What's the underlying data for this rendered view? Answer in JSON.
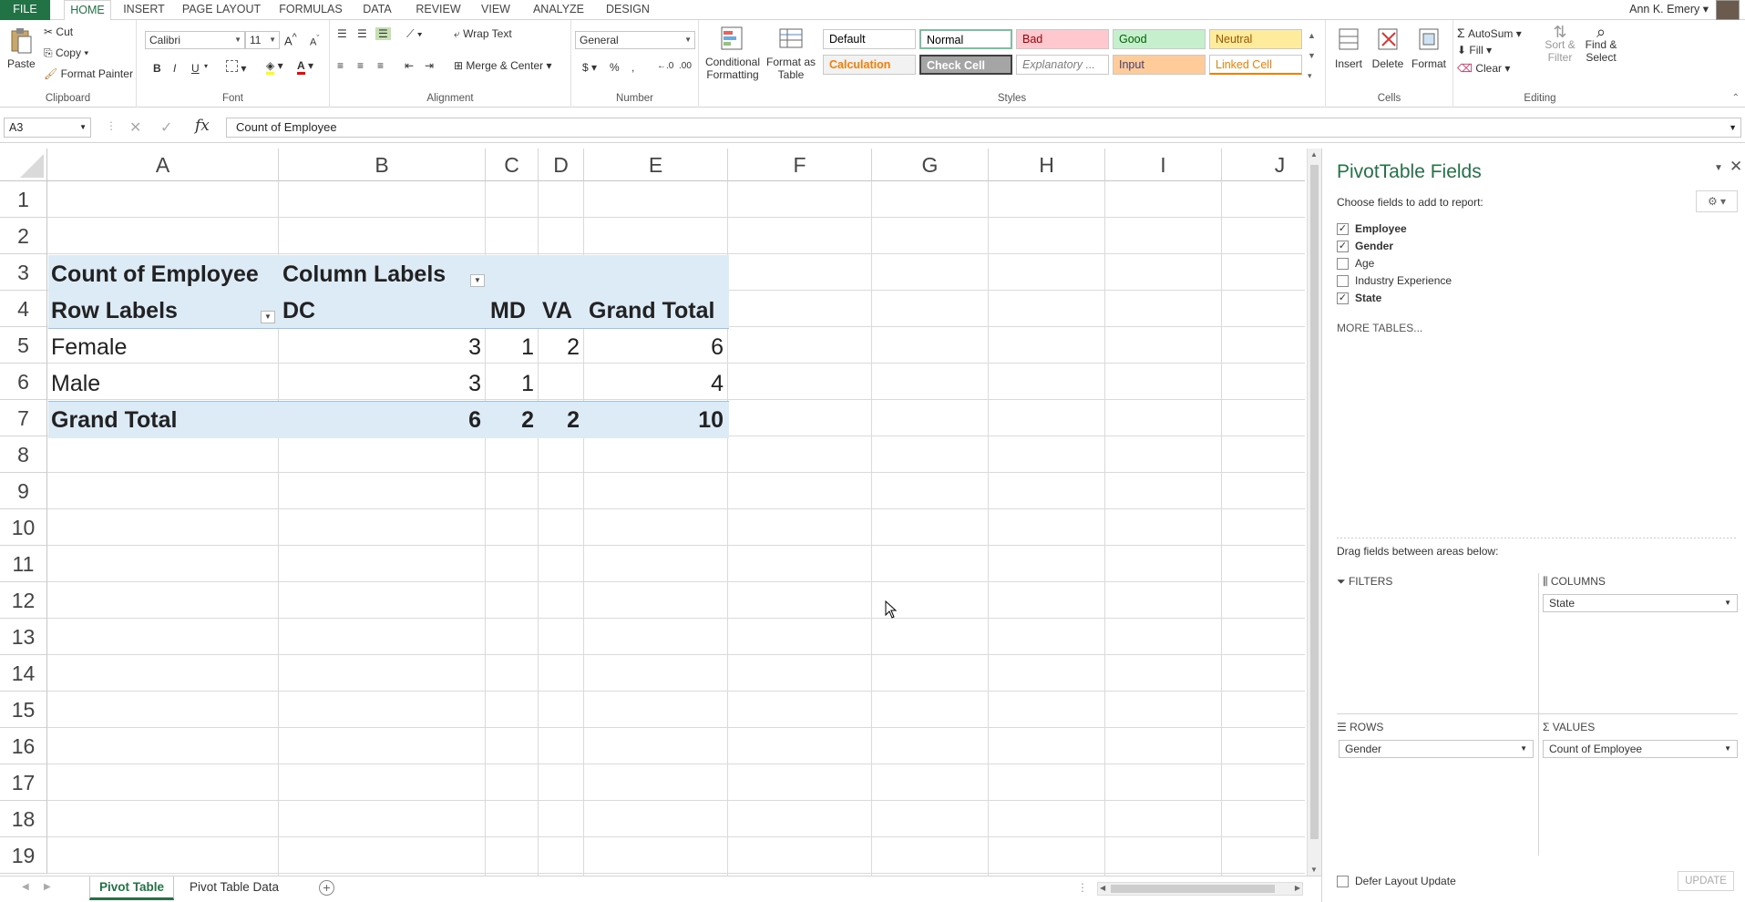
{
  "ribbon_tabs": [
    "FILE",
    "HOME",
    "INSERT",
    "PAGE LAYOUT",
    "FORMULAS",
    "DATA",
    "REVIEW",
    "VIEW",
    "ANALYZE",
    "DESIGN"
  ],
  "user_name": "Ann K. Emery",
  "clipboard": {
    "paste": "Paste",
    "cut": "Cut",
    "copy": "Copy",
    "format_painter": "Format Painter",
    "label": "Clipboard"
  },
  "font": {
    "name": "Calibri",
    "size": "11",
    "label": "Font",
    "bold": "B",
    "italic": "I",
    "underline": "U",
    "font_color_glyph": "A"
  },
  "alignment": {
    "wrap": "Wrap Text",
    "merge": "Merge & Center",
    "label": "Alignment"
  },
  "number": {
    "format": "General",
    "currency": "$",
    "percent": "%",
    "comma": ",",
    "label": "Number"
  },
  "styles_group": {
    "conditional": "Conditional Formatting",
    "format_table": "Format as Table",
    "label": "Styles",
    "cells": [
      {
        "name": "Default",
        "bg": "#ffffff",
        "fg": "#000000"
      },
      {
        "name": "Normal",
        "bg": "#ffffff",
        "fg": "#000000"
      },
      {
        "name": "Bad",
        "bg": "#ffc7ce",
        "fg": "#9c0006"
      },
      {
        "name": "Good",
        "bg": "#c6efce",
        "fg": "#006100"
      },
      {
        "name": "Neutral",
        "bg": "#ffeb9c",
        "fg": "#9c5700"
      },
      {
        "name": "Calculation",
        "bg": "#f2f2f2",
        "fg": "#fa7d00"
      },
      {
        "name": "Check Cell",
        "bg": "#a5a5a5",
        "fg": "#ffffff"
      },
      {
        "name": "Explanatory ...",
        "bg": "#ffffff",
        "fg": "#7f7f7f"
      },
      {
        "name": "Input",
        "bg": "#ffcc99",
        "fg": "#3f3f76"
      },
      {
        "name": "Linked Cell",
        "bg": "#ffffff",
        "fg": "#fa7d00"
      }
    ]
  },
  "cells_group": {
    "insert": "Insert",
    "delete": "Delete",
    "format": "Format",
    "label": "Cells"
  },
  "editing": {
    "autosum": "AutoSum",
    "fill": "Fill",
    "clear": "Clear",
    "sort": "Sort & Filter",
    "find": "Find & Select",
    "label": "Editing"
  },
  "formula_bar": {
    "name_box": "A3",
    "fx": "fx",
    "content": "Count of Employee"
  },
  "columns": [
    "A",
    "B",
    "C",
    "D",
    "E",
    "F",
    "G",
    "H",
    "I",
    "J"
  ],
  "rows": [
    "1",
    "2",
    "3",
    "4",
    "5",
    "6",
    "7",
    "8",
    "9",
    "10",
    "11",
    "12",
    "13",
    "14",
    "15",
    "16",
    "17",
    "18",
    "19"
  ],
  "pivot": {
    "corner": "Count of Employee",
    "column_labels": "Column Labels",
    "row_labels": "Row Labels",
    "states": [
      "DC",
      "MD",
      "VA"
    ],
    "grand_total_header": "Grand Total",
    "body": [
      {
        "label": "Female",
        "values": [
          "3",
          "1",
          "2"
        ],
        "total": "6"
      },
      {
        "label": "Male",
        "values": [
          "3",
          "1",
          ""
        ],
        "total": "4"
      }
    ],
    "grand_total": {
      "label": "Grand Total",
      "values": [
        "6",
        "2",
        "2"
      ],
      "total": "10"
    }
  },
  "sheets": [
    "Pivot Table",
    "Pivot Table Data"
  ],
  "pane": {
    "title": "PivotTable Fields",
    "subtitle": "Choose fields to add to report:",
    "fields": [
      {
        "name": "Employee",
        "checked": true
      },
      {
        "name": "Gender",
        "checked": true
      },
      {
        "name": "Age",
        "checked": false
      },
      {
        "name": "Industry Experience",
        "checked": false
      },
      {
        "name": "State",
        "checked": true
      }
    ],
    "more_tables": "MORE TABLES...",
    "drag_hint": "Drag fields between areas below:",
    "filters": "FILTERS",
    "columns": "COLUMNS",
    "rows": "ROWS",
    "values": "VALUES",
    "columns_item": "State",
    "rows_item": "Gender",
    "values_item": "Count of Employee",
    "defer": "Defer Layout Update",
    "update": "UPDATE"
  },
  "accent": "#217346",
  "pivot_band": "#ddebf7"
}
